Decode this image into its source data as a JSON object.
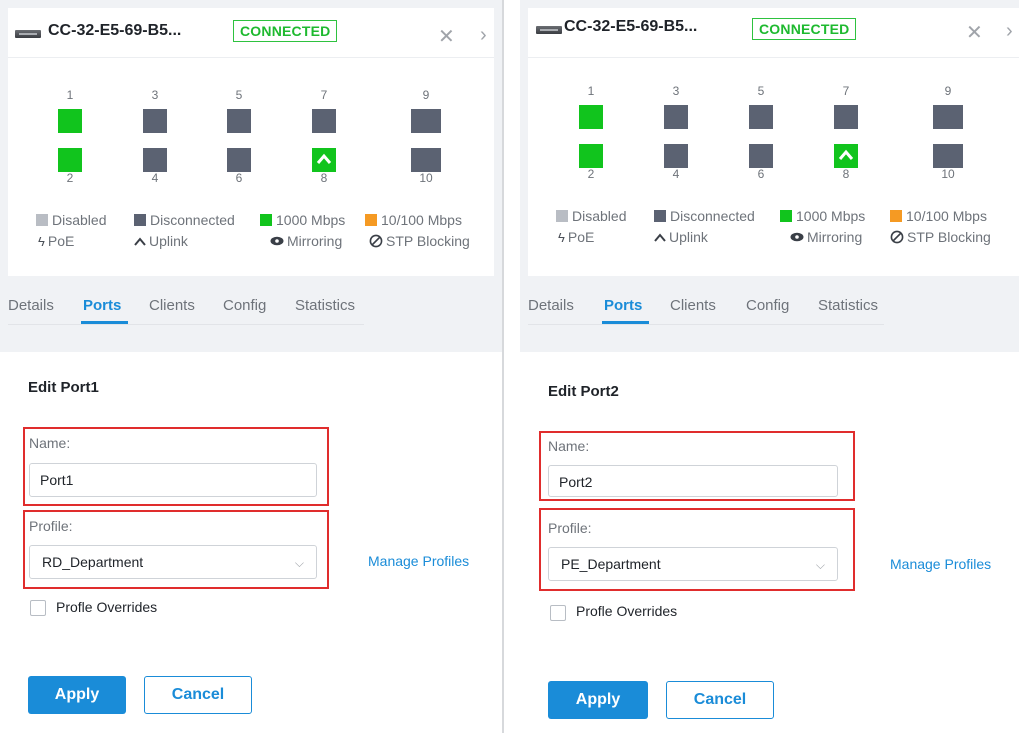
{
  "colors": {
    "accent": "#1a8cd8",
    "connected": "#1eb92f",
    "port_1000": "#11c41d",
    "port_disconnected": "#5b6272",
    "port_disabled": "#b9bdc4",
    "port_10_100": "#f59a23",
    "highlight_box": "#e02d2d"
  },
  "legend": {
    "disabled": "Disabled",
    "disconnected": "Disconnected",
    "gbps": "1000 Mbps",
    "mbps": "10/100 Mbps",
    "poe": "PoE",
    "uplink": "Uplink",
    "mirroring": "Mirroring",
    "stp": "STP Blocking"
  },
  "tabs": [
    "Details",
    "Ports",
    "Clients",
    "Config",
    "Statistics"
  ],
  "active_tab": "Ports",
  "form_labels": {
    "name": "Name:",
    "profile": "Profile:",
    "manage_profiles": "Manage Profiles",
    "overrides": "Profle Overrides",
    "apply": "Apply",
    "cancel": "Cancel"
  },
  "panels": [
    {
      "device_name": "CC-32-E5-69-B5...",
      "status": "CONNECTED",
      "ports": [
        {
          "num": "1",
          "state": "1000 Mbps",
          "icon": ""
        },
        {
          "num": "2",
          "state": "1000 Mbps",
          "icon": ""
        },
        {
          "num": "3",
          "state": "Disconnected",
          "icon": ""
        },
        {
          "num": "4",
          "state": "Disconnected",
          "icon": ""
        },
        {
          "num": "5",
          "state": "Disconnected",
          "icon": ""
        },
        {
          "num": "6",
          "state": "Disconnected",
          "icon": ""
        },
        {
          "num": "7",
          "state": "Disconnected",
          "icon": ""
        },
        {
          "num": "8",
          "state": "1000 Mbps",
          "icon": "uplink-icon"
        },
        {
          "num": "9",
          "state": "Disconnected",
          "icon": ""
        },
        {
          "num": "10",
          "state": "Disconnected",
          "icon": ""
        }
      ],
      "edit_title": "Edit Port1",
      "name_value": "Port1",
      "profile_value": "RD_Department",
      "overrides_checked": false
    },
    {
      "device_name": "CC-32-E5-69-B5...",
      "status": "CONNECTED",
      "ports": [
        {
          "num": "1",
          "state": "1000 Mbps",
          "icon": ""
        },
        {
          "num": "2",
          "state": "1000 Mbps",
          "icon": ""
        },
        {
          "num": "3",
          "state": "Disconnected",
          "icon": ""
        },
        {
          "num": "4",
          "state": "Disconnected",
          "icon": ""
        },
        {
          "num": "5",
          "state": "Disconnected",
          "icon": ""
        },
        {
          "num": "6",
          "state": "Disconnected",
          "icon": ""
        },
        {
          "num": "7",
          "state": "Disconnected",
          "icon": ""
        },
        {
          "num": "8",
          "state": "1000 Mbps",
          "icon": "uplink-icon"
        },
        {
          "num": "9",
          "state": "Disconnected",
          "icon": ""
        },
        {
          "num": "10",
          "state": "Disconnected",
          "icon": ""
        }
      ],
      "edit_title": "Edit Port2",
      "name_value": "Port2",
      "profile_value": "PE_Department",
      "overrides_checked": false
    }
  ]
}
